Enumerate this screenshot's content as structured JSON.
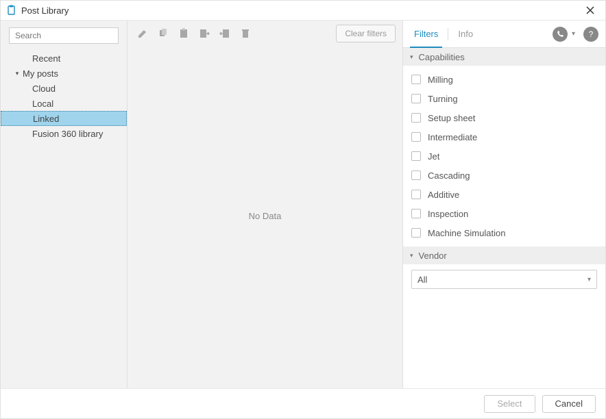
{
  "window": {
    "title": "Post Library"
  },
  "search": {
    "placeholder": "Search"
  },
  "tree": {
    "recent": "Recent",
    "my_posts": "My posts",
    "cloud": "Cloud",
    "local": "Local",
    "linked": "Linked",
    "fusion_lib": "Fusion 360 library"
  },
  "toolbar": {
    "clear_filters": "Clear filters"
  },
  "middle": {
    "no_data": "No Data"
  },
  "right": {
    "tabs": {
      "filters": "Filters",
      "info": "Info"
    },
    "sections": {
      "capabilities": "Capabilities",
      "vendor": "Vendor"
    },
    "capabilities": {
      "milling": "Milling",
      "turning": "Turning",
      "setup_sheet": "Setup sheet",
      "intermediate": "Intermediate",
      "jet": "Jet",
      "cascading": "Cascading",
      "additive": "Additive",
      "inspection": "Inspection",
      "machine_sim": "Machine Simulation"
    },
    "vendor_value": "All"
  },
  "footer": {
    "select": "Select",
    "cancel": "Cancel"
  }
}
